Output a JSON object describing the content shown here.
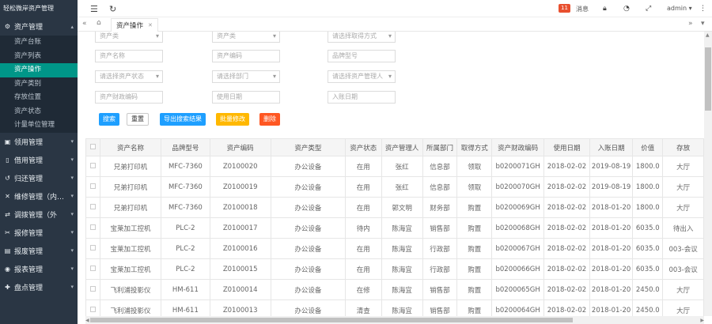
{
  "app": {
    "title": "轻松微岸资产管理"
  },
  "sidebar": {
    "groups": [
      {
        "label": "资产管理",
        "icon": "gear-icon",
        "glyph": "⚙",
        "expanded": true,
        "items": [
          {
            "label": "资产台账"
          },
          {
            "label": "资产列表"
          },
          {
            "label": "资产操作",
            "active": true
          },
          {
            "label": "资产类别"
          },
          {
            "label": "存放位置"
          },
          {
            "label": "资产状态"
          },
          {
            "label": "计量单位管理"
          }
        ]
      },
      {
        "label": "领用管理",
        "icon": "gift-icon",
        "glyph": "▣"
      },
      {
        "label": "借用管理",
        "icon": "file-icon",
        "glyph": "▯"
      },
      {
        "label": "归还管理",
        "icon": "undo-icon",
        "glyph": "↺"
      },
      {
        "label": "维修管理（内…",
        "icon": "wrench-icon",
        "glyph": "✕"
      },
      {
        "label": "调拨管理（外",
        "icon": "transfer-icon",
        "glyph": "⇄"
      },
      {
        "label": "报修管理",
        "icon": "tool-icon",
        "glyph": "✂"
      },
      {
        "label": "报废管理",
        "icon": "trash-icon",
        "glyph": "▤"
      },
      {
        "label": "报表管理",
        "icon": "chart-icon",
        "glyph": "◉"
      },
      {
        "label": "盘点管理",
        "icon": "clipboard-icon",
        "glyph": "✚"
      }
    ]
  },
  "header": {
    "notif_count": "11",
    "notif_label": "消息",
    "user": "admin"
  },
  "tabs": [
    {
      "label": "资产操作"
    }
  ],
  "filters": {
    "row1": [
      "资产类",
      "资产类",
      "请选择取得方式"
    ],
    "row2": [
      "资产名称",
      "资产编码",
      "品牌型号"
    ],
    "row3": [
      "请选择资产状态",
      "请选择部门",
      "请选择资产管理人"
    ],
    "row4": [
      "资产财政编码",
      "使用日期",
      "入账日期"
    ]
  },
  "buttons": {
    "search": "搜索",
    "reset": "重置",
    "export": "导出搜索结果",
    "batch_edit": "批量修改",
    "delete": "删除"
  },
  "table": {
    "headers": [
      "资产名称",
      "品牌型号",
      "资产编码",
      "资产类型",
      "资产状态",
      "资产管理人",
      "所属部门",
      "取得方式",
      "资产财政编码",
      "使用日期",
      "入账日期",
      "价值",
      "存放"
    ],
    "rows": [
      [
        "兄弟打印机",
        "MFC-7360",
        "Z0100020",
        "办公设备",
        "在用",
        "张红",
        "信息部",
        "领取",
        "b0200071GH",
        "2018-02-02",
        "2019-08-19",
        "1800.0",
        "大厅"
      ],
      [
        "兄弟打印机",
        "MFC-7360",
        "Z0100019",
        "办公设备",
        "在用",
        "张红",
        "信息部",
        "领取",
        "b0200070GH",
        "2018-02-02",
        "2019-08-19",
        "1800.0",
        "大厅"
      ],
      [
        "兄弟打印机",
        "MFC-7360",
        "Z0100018",
        "办公设备",
        "在用",
        "郭文明",
        "财务部",
        "购置",
        "b0200069GH",
        "2018-02-02",
        "2018-01-20",
        "1800.0",
        "大厅"
      ],
      [
        "宝莱加工控机",
        "PLC-2",
        "Z0100017",
        "办公设备",
        "待内",
        "陈海宜",
        "销售部",
        "购置",
        "b0200068GH",
        "2018-02-02",
        "2018-01-20",
        "6035.0",
        "待出入"
      ],
      [
        "宝莱加工控机",
        "PLC-2",
        "Z0100016",
        "办公设备",
        "在用",
        "陈海宜",
        "行政部",
        "购置",
        "b0200067GH",
        "2018-02-02",
        "2018-01-20",
        "6035.0",
        "003-会议"
      ],
      [
        "宝莱加工控机",
        "PLC-2",
        "Z0100015",
        "办公设备",
        "在用",
        "陈海宜",
        "行政部",
        "购置",
        "b0200066GH",
        "2018-02-02",
        "2018-01-20",
        "6035.0",
        "003-会议"
      ],
      [
        "飞利浦投影仪",
        "HM-611",
        "Z0100014",
        "办公设备",
        "在修",
        "陈海宜",
        "销售部",
        "购置",
        "b0200065GH",
        "2018-02-02",
        "2018-01-20",
        "2450.0",
        "大厅"
      ],
      [
        "飞利浦投影仪",
        "HM-611",
        "Z0100013",
        "办公设备",
        "清查",
        "陈海宜",
        "销售部",
        "购置",
        "b0200064GH",
        "2018-02-02",
        "2018-01-20",
        "2450.0",
        "大厅"
      ]
    ]
  }
}
